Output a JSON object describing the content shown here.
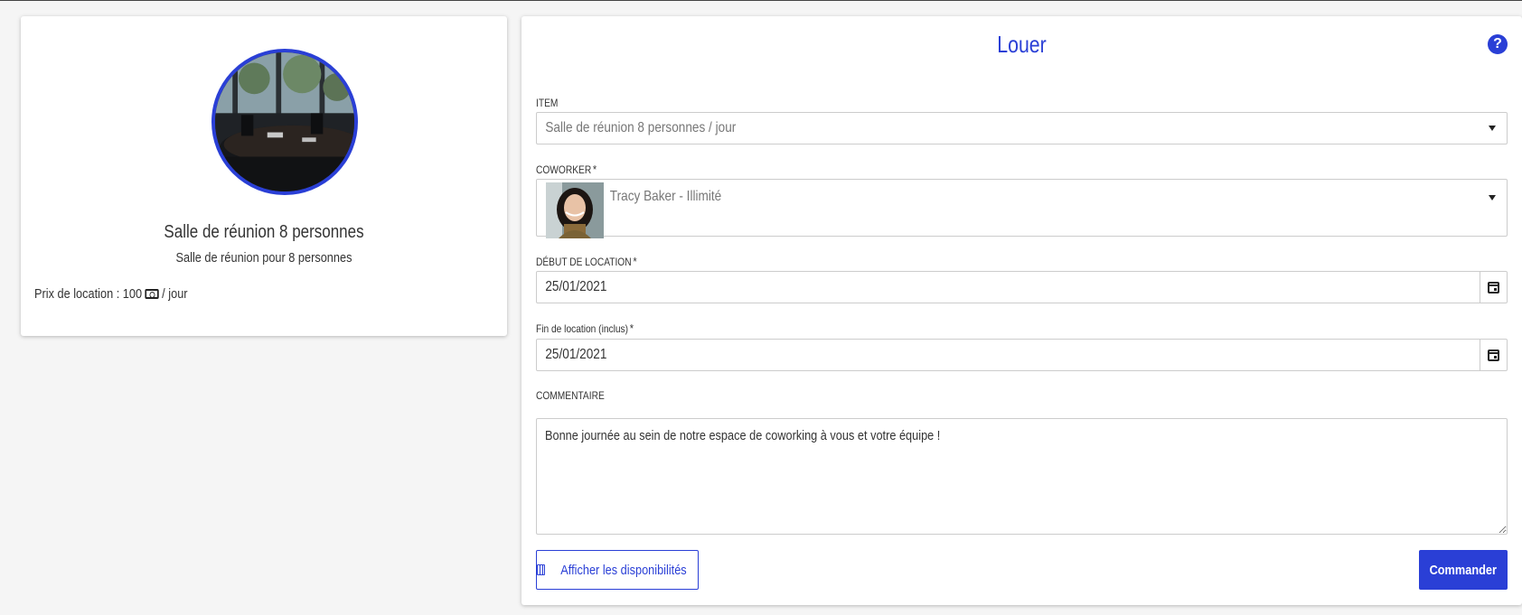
{
  "item_card": {
    "name": "Salle de réunion 8 personnes",
    "description": "Salle de réunion pour 8 personnes",
    "price_prefix": "Prix de location : 100",
    "price_suffix": "/ jour",
    "currency_icon": "money-bill-icon",
    "image_icon": "meeting-room-photo"
  },
  "form": {
    "title": "Louer",
    "help_icon": "question-circle-icon",
    "item": {
      "label": "ITEM",
      "value": "Salle de réunion 8 personnes / jour"
    },
    "coworker": {
      "label": "COWORKER",
      "required_mark": "*",
      "value": "Tracy Baker - Illimité"
    },
    "start": {
      "label": "DÉBUT DE LOCATION",
      "required_mark": "*",
      "value": "25/01/2021"
    },
    "end": {
      "label": "Fin de location (inclus)",
      "required_mark": "*",
      "value": "25/01/2021"
    },
    "comment": {
      "label": "COMMENTAIRE",
      "value": "Bonne journée au sein de notre espace de coworking à vous et votre équipe !"
    },
    "availability_button": "Afficher les disponibilités",
    "submit_button": "Commander"
  },
  "colors": {
    "accent": "#2a3fd6",
    "background": "#f5f5f5"
  }
}
